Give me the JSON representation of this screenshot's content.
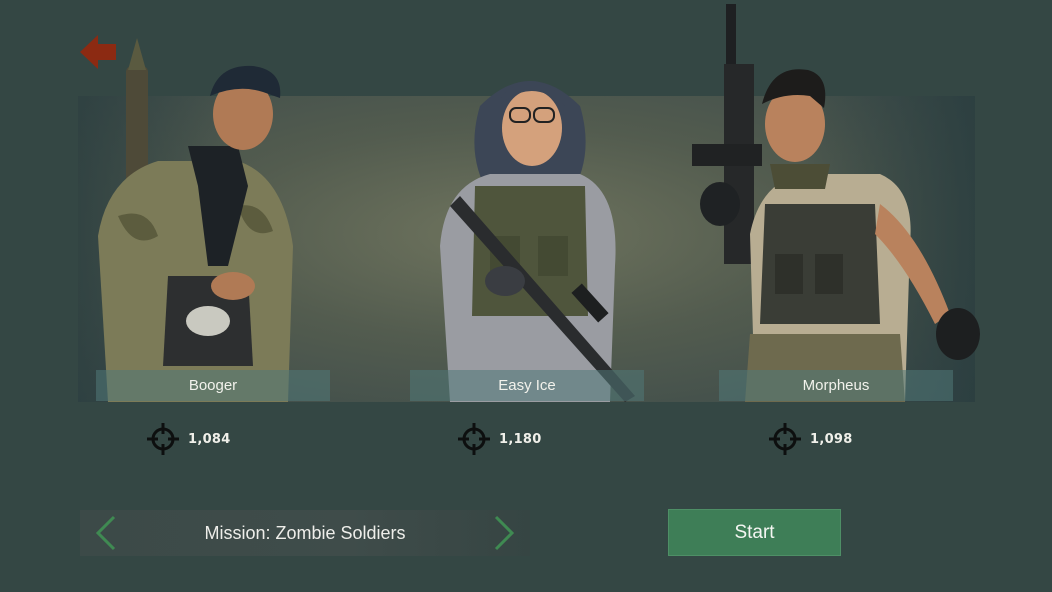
{
  "colors": {
    "background": "#344744",
    "back_arrow": "#8c2a12",
    "nav_arrow": "#3f8a52",
    "start_button": "#3e7e57"
  },
  "header": {
    "back_icon": "back-arrow-icon"
  },
  "squad": [
    {
      "name": "Booger",
      "stat": "1,084",
      "stat_icon": "crosshair-icon"
    },
    {
      "name": "Easy Ice",
      "stat": "1,180",
      "stat_icon": "crosshair-icon"
    },
    {
      "name": "Morpheus",
      "stat": "1,098",
      "stat_icon": "crosshair-icon"
    }
  ],
  "mission": {
    "label": "Mission: Zombie Soldiers",
    "prev_icon": "chevron-left-icon",
    "next_icon": "chevron-right-icon"
  },
  "start": {
    "label": "Start"
  }
}
